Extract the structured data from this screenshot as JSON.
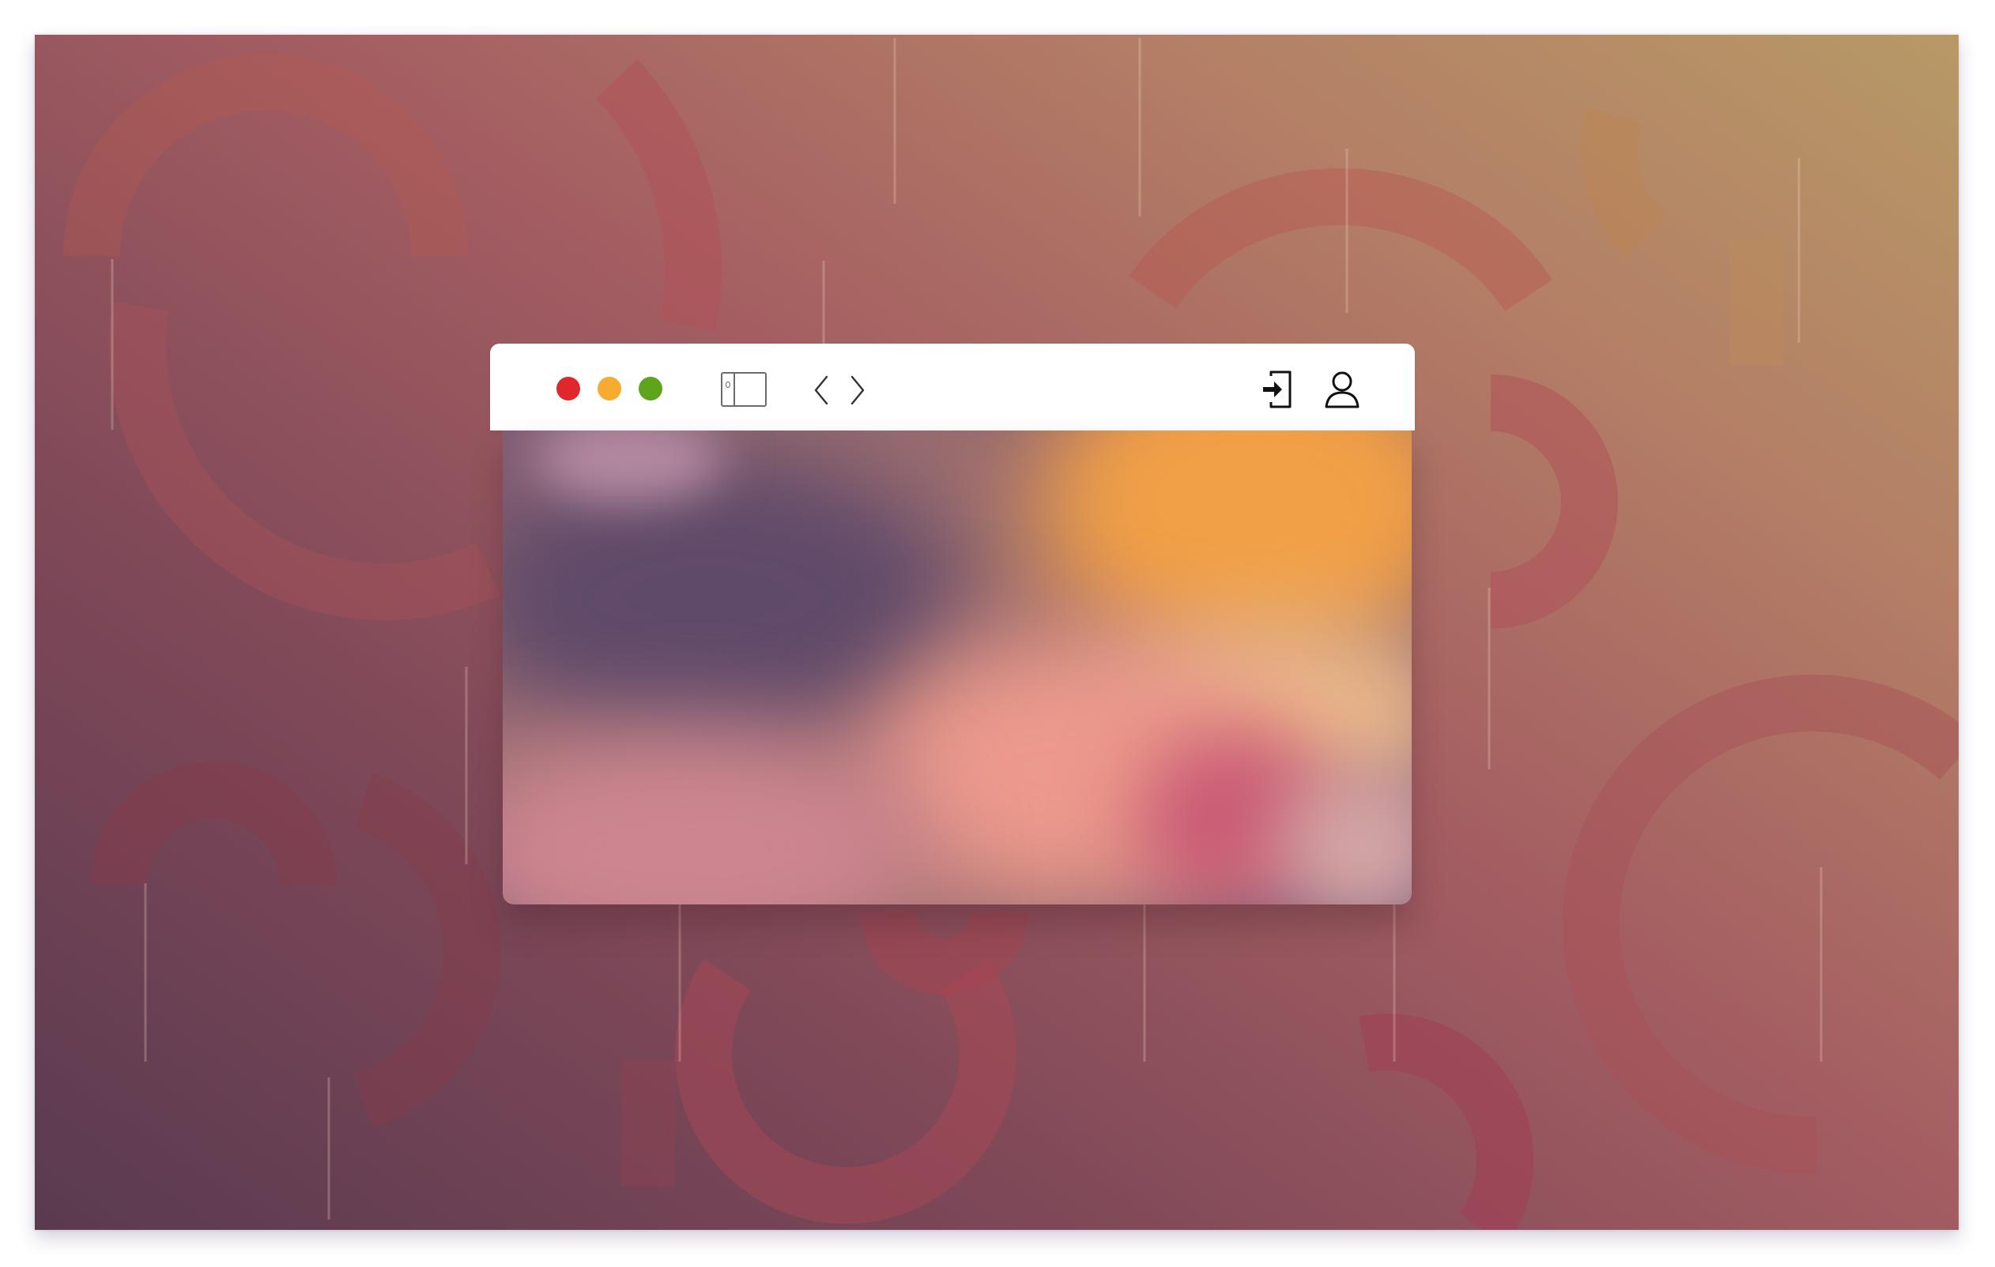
{
  "window": {
    "traffic_lights": [
      {
        "name": "close",
        "color": "#e0282c"
      },
      {
        "name": "minimize",
        "color": "#f7ab31"
      },
      {
        "name": "zoom",
        "color": "#5fa51c"
      }
    ],
    "toolbar": {
      "sidebar_toggle_icon": "sidebar-toggle-icon",
      "back_icon": "chevron-left-icon",
      "forward_icon": "chevron-right-icon",
      "sign_in_icon": "sign-in-icon",
      "profile_icon": "user-profile-icon"
    },
    "content_colors": {
      "plum": "#6a506e",
      "orange": "#f2a046",
      "salmon": "#eb9a8d",
      "rose": "#c95a75",
      "pink": "#d58c8c"
    }
  },
  "wallpaper": {
    "colors": {
      "dark_plum": "#5a3a50",
      "mauve": "#7e4858",
      "rose": "#a45e62",
      "tan": "#b47f66",
      "gold": "#b79966",
      "arc": "#b0525a"
    }
  }
}
